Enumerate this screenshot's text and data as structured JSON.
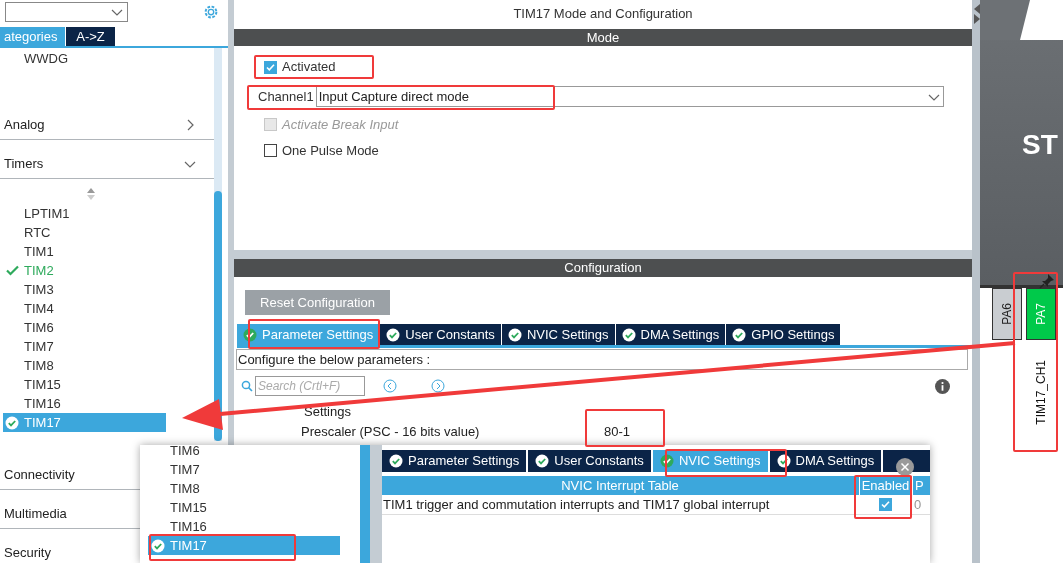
{
  "sidebar": {
    "tabs": [
      {
        "label": "ategories",
        "selected": true
      },
      {
        "label": "A->Z",
        "selected": false
      }
    ],
    "top_items": [
      "WWDG"
    ],
    "categories": [
      {
        "label": "Analog",
        "expanded": false
      },
      {
        "label": "Timers",
        "expanded": true,
        "children": [
          {
            "label": "LPTIM1",
            "configured": false,
            "selected": false
          },
          {
            "label": "RTC",
            "configured": false,
            "selected": false
          },
          {
            "label": "TIM1",
            "configured": false,
            "selected": false
          },
          {
            "label": "TIM2",
            "configured": true,
            "selected": false
          },
          {
            "label": "TIM3",
            "configured": false,
            "selected": false
          },
          {
            "label": "TIM4",
            "configured": false,
            "selected": false
          },
          {
            "label": "TIM6",
            "configured": false,
            "selected": false
          },
          {
            "label": "TIM7",
            "configured": false,
            "selected": false
          },
          {
            "label": "TIM8",
            "configured": false,
            "selected": false
          },
          {
            "label": "TIM15",
            "configured": false,
            "selected": false
          },
          {
            "label": "TIM16",
            "configured": false,
            "selected": false
          },
          {
            "label": "TIM17",
            "configured": true,
            "selected": true
          }
        ]
      },
      {
        "label": "Connectivity"
      },
      {
        "label": "Multimedia"
      },
      {
        "label": "Security"
      }
    ]
  },
  "main": {
    "title": "TIM17 Mode and Configuration",
    "mode": {
      "header": "Mode",
      "activated": {
        "label": "Activated",
        "checked": true
      },
      "channel": {
        "label": "Channel1",
        "value": "Input Capture direct mode"
      },
      "options": [
        {
          "label": "Activate Break Input",
          "checked": false,
          "disabled": true
        },
        {
          "label": "One Pulse Mode",
          "checked": false,
          "disabled": false
        }
      ]
    },
    "configuration": {
      "header": "Configuration",
      "reset_button": "Reset Configuration",
      "tabs": [
        {
          "label": "Parameter Settings",
          "selected": true
        },
        {
          "label": "User Constants",
          "selected": false
        },
        {
          "label": "NVIC Settings",
          "selected": false
        },
        {
          "label": "DMA Settings",
          "selected": false
        },
        {
          "label": "GPIO Settings",
          "selected": false
        }
      ],
      "description": "Configure the below parameters :",
      "search": {
        "placeholder": "Search (Crtl+F)"
      },
      "section": "Settings",
      "parameters": [
        {
          "name": "Prescaler (PSC - 16 bits value)",
          "value": "80-1"
        }
      ]
    }
  },
  "chip": {
    "logo": "ST",
    "pins": [
      {
        "label": "PA6",
        "assigned": false
      },
      {
        "label": "PA7",
        "assigned": true,
        "signal": "TIM17_CH1"
      }
    ]
  },
  "inset": {
    "items": [
      {
        "label": "TIM6",
        "selected": false
      },
      {
        "label": "TIM7",
        "selected": false
      },
      {
        "label": "TIM8",
        "selected": false
      },
      {
        "label": "TIM15",
        "selected": false
      },
      {
        "label": "TIM16",
        "selected": false
      },
      {
        "label": "TIM17",
        "selected": true
      }
    ],
    "tabs": [
      {
        "label": "Parameter Settings",
        "selected": false
      },
      {
        "label": "User Constants",
        "selected": false
      },
      {
        "label": "NVIC Settings",
        "selected": true
      },
      {
        "label": "DMA Settings",
        "selected": false
      }
    ],
    "table": {
      "columns": [
        "NVIC Interrupt Table",
        "Enabled",
        "P"
      ],
      "rows": [
        {
          "name": "TIM1 trigger and commutation interrupts and TIM17 global interrupt",
          "enabled": true,
          "column_3": "0"
        }
      ]
    }
  }
}
